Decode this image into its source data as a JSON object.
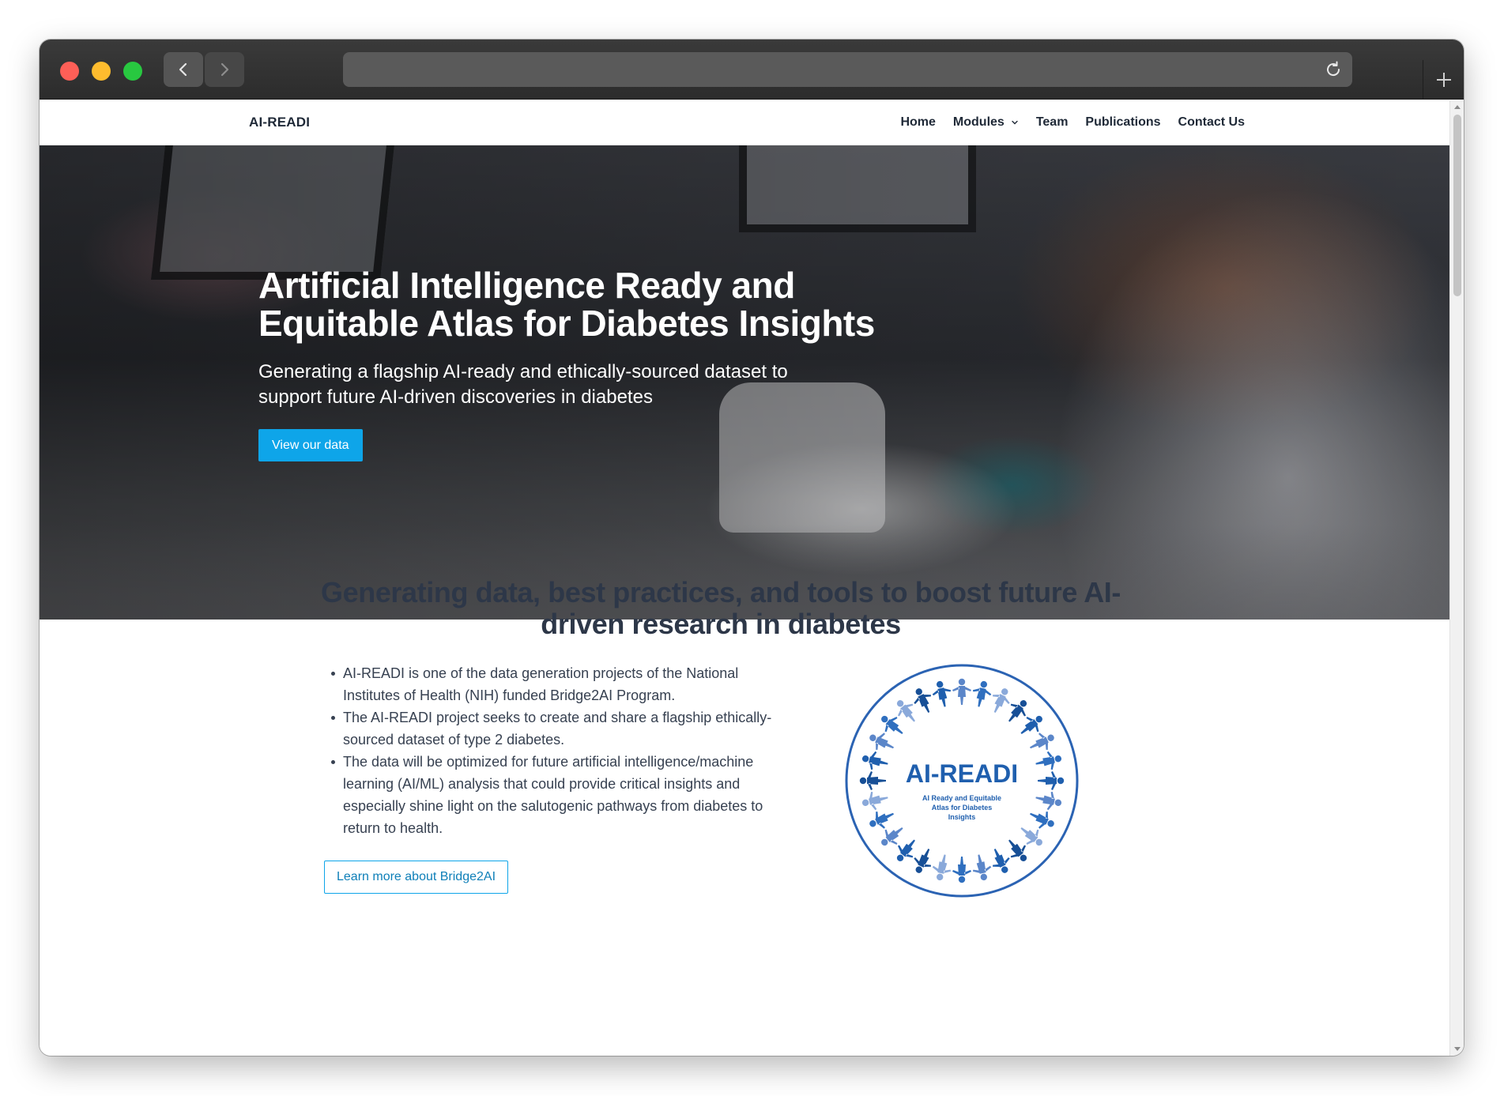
{
  "browser": {
    "url": ""
  },
  "nav": {
    "brand": "AI-READI",
    "items": [
      {
        "label": "Home"
      },
      {
        "label": "Modules"
      },
      {
        "label": "Team"
      },
      {
        "label": "Publications"
      },
      {
        "label": "Contact Us"
      }
    ]
  },
  "hero": {
    "title": "Artificial Intelligence Ready and Equitable Atlas for Diabetes Insights",
    "subtitle": "Generating a flagship AI-ready and ethically-sourced dataset to support future AI-driven discoveries in diabetes",
    "button": "View our data"
  },
  "intro": {
    "title": "Generating data, best practices, and tools to boost future AI-driven research in diabetes",
    "bullets": [
      "AI-READI is one of the data generation projects of the National Institutes of Health (NIH) funded Bridge2AI Program.",
      "The AI-READI project seeks to create and share a flagship ethically-sourced dataset of type 2 diabetes.",
      "The data will be optimized for future artificial intelligence/machine learning (AI/ML) analysis that could provide critical insights and especially shine light on the salutogenic pathways from diabetes to return to health."
    ],
    "button": "Learn more about Bridge2AI"
  },
  "logo": {
    "name": "AI-READI",
    "tagline_lines": [
      "AI Ready and Equitable",
      "Atlas for Diabetes",
      "Insights"
    ]
  },
  "colors": {
    "accent": "#0ea5e9",
    "logo_blue": "#1f5fae",
    "text_dark": "#1f2937"
  }
}
